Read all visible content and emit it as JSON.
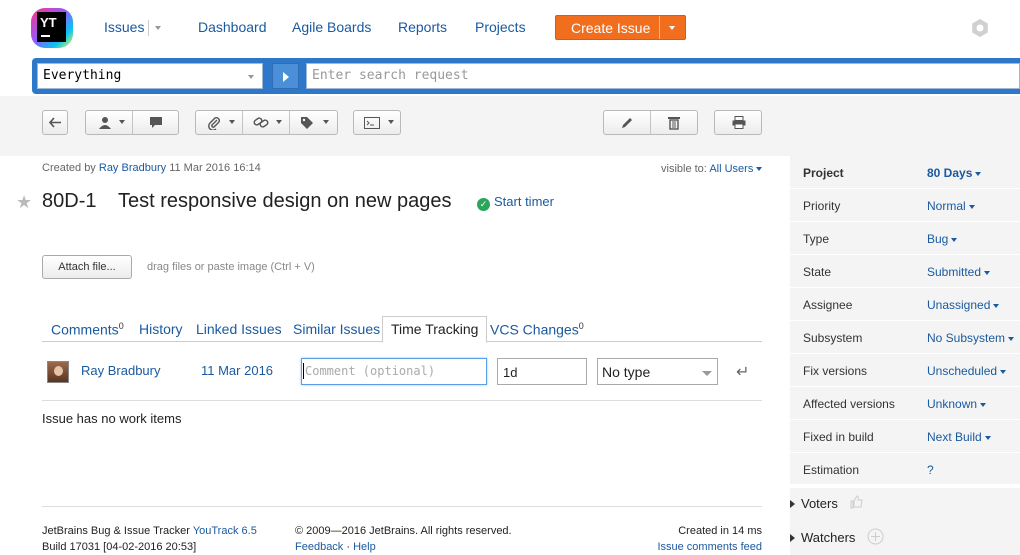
{
  "nav": {
    "logo_text": "YT",
    "issues": "Issues",
    "dashboard": "Dashboard",
    "agile_boards": "Agile Boards",
    "reports": "Reports",
    "projects": "Projects",
    "create_issue": "Create Issue",
    "settings_icon": "gear-icon"
  },
  "search": {
    "context": "Everything",
    "placeholder": "Enter search request"
  },
  "toolbar": {
    "icons": [
      "back-arrow-icon",
      "assignee-icon",
      "comment-icon",
      "attachment-icon",
      "link-icon",
      "tag-icon",
      "command-icon",
      "edit-icon",
      "delete-icon",
      "print-icon"
    ]
  },
  "issue": {
    "created_by_label": "Created by",
    "author": "Ray Bradbury",
    "created_date": "11 Mar 2016 16:14",
    "visible_to_label": "visible to:",
    "visible_to": "All Users",
    "id": "80D-1",
    "title": "Test responsive design on new pages",
    "start_timer": "Start timer",
    "attach_label": "Attach file...",
    "drag_hint": "drag files or paste image (Ctrl + V)"
  },
  "tabs": [
    {
      "label": "Comments",
      "count": "0"
    },
    {
      "label": "History"
    },
    {
      "label": "Linked Issues"
    },
    {
      "label": "Similar Issues"
    },
    {
      "label": "Time Tracking",
      "active": true
    },
    {
      "label": "VCS Changes",
      "count": "0"
    }
  ],
  "work_item": {
    "author": "Ray Bradbury",
    "date": "11 Mar 2016",
    "comment_placeholder": "Comment (optional)",
    "duration": "1d",
    "type": "No type",
    "empty_text": "Issue has no work items"
  },
  "footer": {
    "product_line": "JetBrains Bug & Issue Tracker",
    "product_link": "YouTrack 6.5",
    "build": "Build 17031 [04-02-2016 20:53]",
    "copyright": "© 2009—2016 JetBrains. All rights reserved.",
    "feedback": "Feedback",
    "help": "Help",
    "sep": "·",
    "created_in": "Created in 14 ms",
    "comments_feed": "Issue comments feed"
  },
  "fields": [
    {
      "name": "Project",
      "value": "80 Days",
      "caret": true,
      "bold": true
    },
    {
      "name": "Priority",
      "value": "Normal",
      "caret": true
    },
    {
      "name": "Type",
      "value": "Bug",
      "caret": true
    },
    {
      "name": "State",
      "value": "Submitted",
      "caret": true
    },
    {
      "name": "Assignee",
      "value": "Unassigned",
      "caret": true
    },
    {
      "name": "Subsystem",
      "value": "No Subsystem",
      "caret": true
    },
    {
      "name": "Fix versions",
      "value": "Unscheduled",
      "caret": true
    },
    {
      "name": "Affected versions",
      "value": "Unknown",
      "caret": true
    },
    {
      "name": "Fixed in build",
      "value": "Next Build",
      "caret": true
    },
    {
      "name": "Estimation",
      "value": "?",
      "caret": false
    }
  ],
  "sidebar_sections": {
    "voters": "Voters",
    "watchers": "Watchers"
  }
}
